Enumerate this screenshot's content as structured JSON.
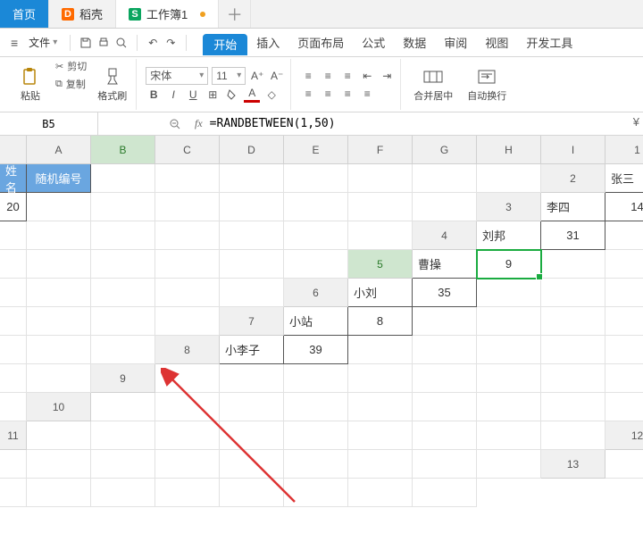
{
  "tabs": {
    "home": "首页",
    "shell": "稻壳",
    "book": "工作簿1"
  },
  "menu": {
    "file": "文件",
    "ribbon": [
      "开始",
      "插入",
      "页面布局",
      "公式",
      "数据",
      "审阅",
      "视图",
      "开发工具"
    ]
  },
  "toolbar": {
    "paste": "粘贴",
    "cut": "剪切",
    "copy": "复制",
    "brush": "格式刷",
    "font_name": "宋体",
    "font_size": "11",
    "merge": "合并居中",
    "wrap": "自动换行"
  },
  "fx": {
    "cell_ref": "B5",
    "formula": "=RANDBETWEEN(1,50)"
  },
  "columns": [
    "A",
    "B",
    "C",
    "D",
    "E",
    "F",
    "G",
    "H",
    "I"
  ],
  "rows": [
    "1",
    "2",
    "3",
    "4",
    "5",
    "6",
    "7",
    "8",
    "9",
    "10",
    "11",
    "12",
    "13"
  ],
  "headers": {
    "a": "姓名",
    "b": "随机编号"
  },
  "data": {
    "names": [
      "张三",
      "李四",
      "刘邦",
      "曹操",
      "小刘",
      "小站",
      "小李子"
    ],
    "nums": [
      "20",
      "14",
      "31",
      "9",
      "35",
      "8",
      "39"
    ]
  },
  "currency": "¥",
  "sel_row": 5,
  "sel_col": "B"
}
